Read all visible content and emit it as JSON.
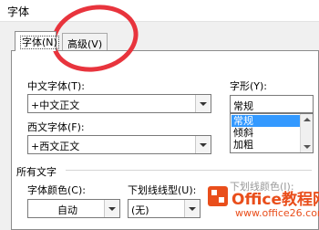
{
  "dialog": {
    "title": "字体"
  },
  "tabs": [
    {
      "label": "字体(N)"
    },
    {
      "label": "高级(V)"
    }
  ],
  "fields": {
    "chinese_font": {
      "label": "中文字体(T):",
      "value": "+中文正文"
    },
    "western_font": {
      "label": "西文字体(F):",
      "value": "+西文正文"
    },
    "font_style": {
      "label": "字形(Y):",
      "value": "常规",
      "options": [
        "常规",
        "倾斜",
        "加粗"
      ],
      "selected": "常规"
    }
  },
  "all_text": {
    "section_label": "所有文字",
    "font_color": {
      "label": "字体颜色(C):",
      "value": "自动"
    },
    "underline_style": {
      "label": "下划线线型(U):",
      "value": "(无)"
    },
    "underline_color": {
      "label": "下划线颜色(I):"
    }
  },
  "watermark": {
    "title": "Office教程网",
    "subtitle": "www.office26.com"
  },
  "colors": {
    "annotation_circle": "#e8343d",
    "selection": "#3399ff",
    "watermark": "#e94e1b"
  }
}
